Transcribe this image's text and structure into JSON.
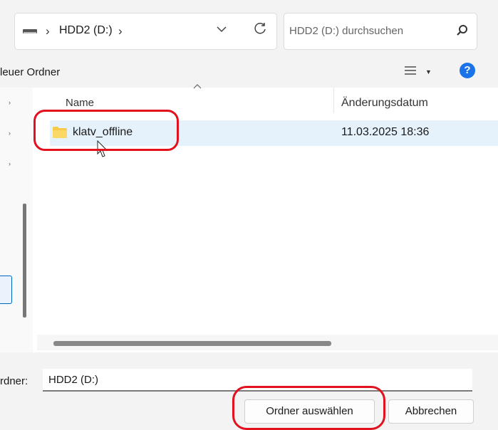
{
  "address_bar": {
    "separator_1": "›",
    "breadcrumb": "HDD2 (D:)",
    "separator_2": "›"
  },
  "search": {
    "placeholder": "HDD2 (D:) durchsuchen"
  },
  "toolbar": {
    "new_folder_label": "leuer Ordner"
  },
  "nav": {
    "chevrons": [
      "›",
      "›",
      "›"
    ]
  },
  "file_list": {
    "columns": [
      "Name",
      "Änderungsdatum"
    ],
    "rows": [
      {
        "name": "klatv_offline",
        "modified": "11.03.2025 18:36"
      }
    ]
  },
  "footer": {
    "folder_label": "rdner:",
    "folder_value": "HDD2 (D:)",
    "select_button": "Ordner auswählen",
    "cancel_button": "Abbrechen"
  },
  "icons": {
    "drive": "drive-icon",
    "dropdown": "chevron-down-icon",
    "refresh": "refresh-icon",
    "search": "search-icon",
    "view": "view-options-icon",
    "help": "help-icon",
    "folder": "folder-icon",
    "cursor": "mouse-cursor-icon"
  },
  "colors": {
    "accent": "#0067c0",
    "selection": "#e6f2fb",
    "folder": "#f7c948",
    "annotation": "#e3101e",
    "help": "#1a73e8"
  }
}
